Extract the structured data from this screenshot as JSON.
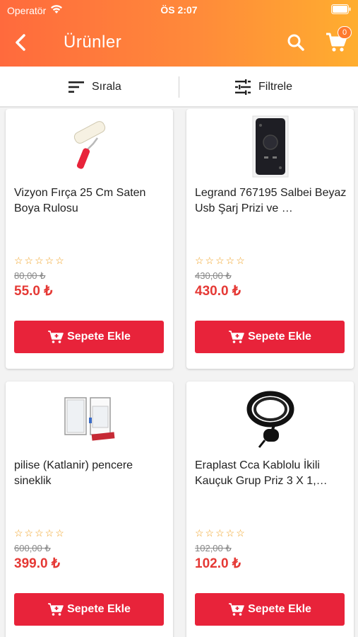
{
  "status_bar": {
    "carrier": "Operatör",
    "time": "ÖS 2:07"
  },
  "header": {
    "title": "Ürünler",
    "cart_count": "0"
  },
  "toolbar": {
    "sort_label": "Sırala",
    "filter_label": "Filtrele"
  },
  "products": [
    {
      "name": "Vizyon Fırça 25 Cm Saten Boya Rulosu",
      "rating_stars": "☆☆☆☆☆",
      "old_price": "80,00 ₺",
      "price": "55.0 ₺",
      "button": "Sepete Ekle"
    },
    {
      "name": "Legrand 767195 Salbei Beyaz Usb Şarj Prizi ve …",
      "rating_stars": "☆☆☆☆☆",
      "old_price": "430,00 ₺",
      "price": "430.0 ₺",
      "button": "Sepete Ekle"
    },
    {
      "name": "pilise (Katlanir) pencere sineklik",
      "rating_stars": "☆☆☆☆☆",
      "old_price": "600,00 ₺",
      "price": "399.0 ₺",
      "button": "Sepete Ekle"
    },
    {
      "name": "Eraplast Cca Kablolu İkili Kauçuk Grup Priz 3 X 1,…",
      "rating_stars": "☆☆☆☆☆",
      "old_price": "102,00 ₺",
      "price": "102.0 ₺",
      "button": "Sepete Ekle"
    }
  ],
  "colors": {
    "header_start": "#ff6a3d",
    "header_end": "#ffae2f",
    "button": "#e8233a",
    "price": "#e53935",
    "star": "#f0a020"
  }
}
